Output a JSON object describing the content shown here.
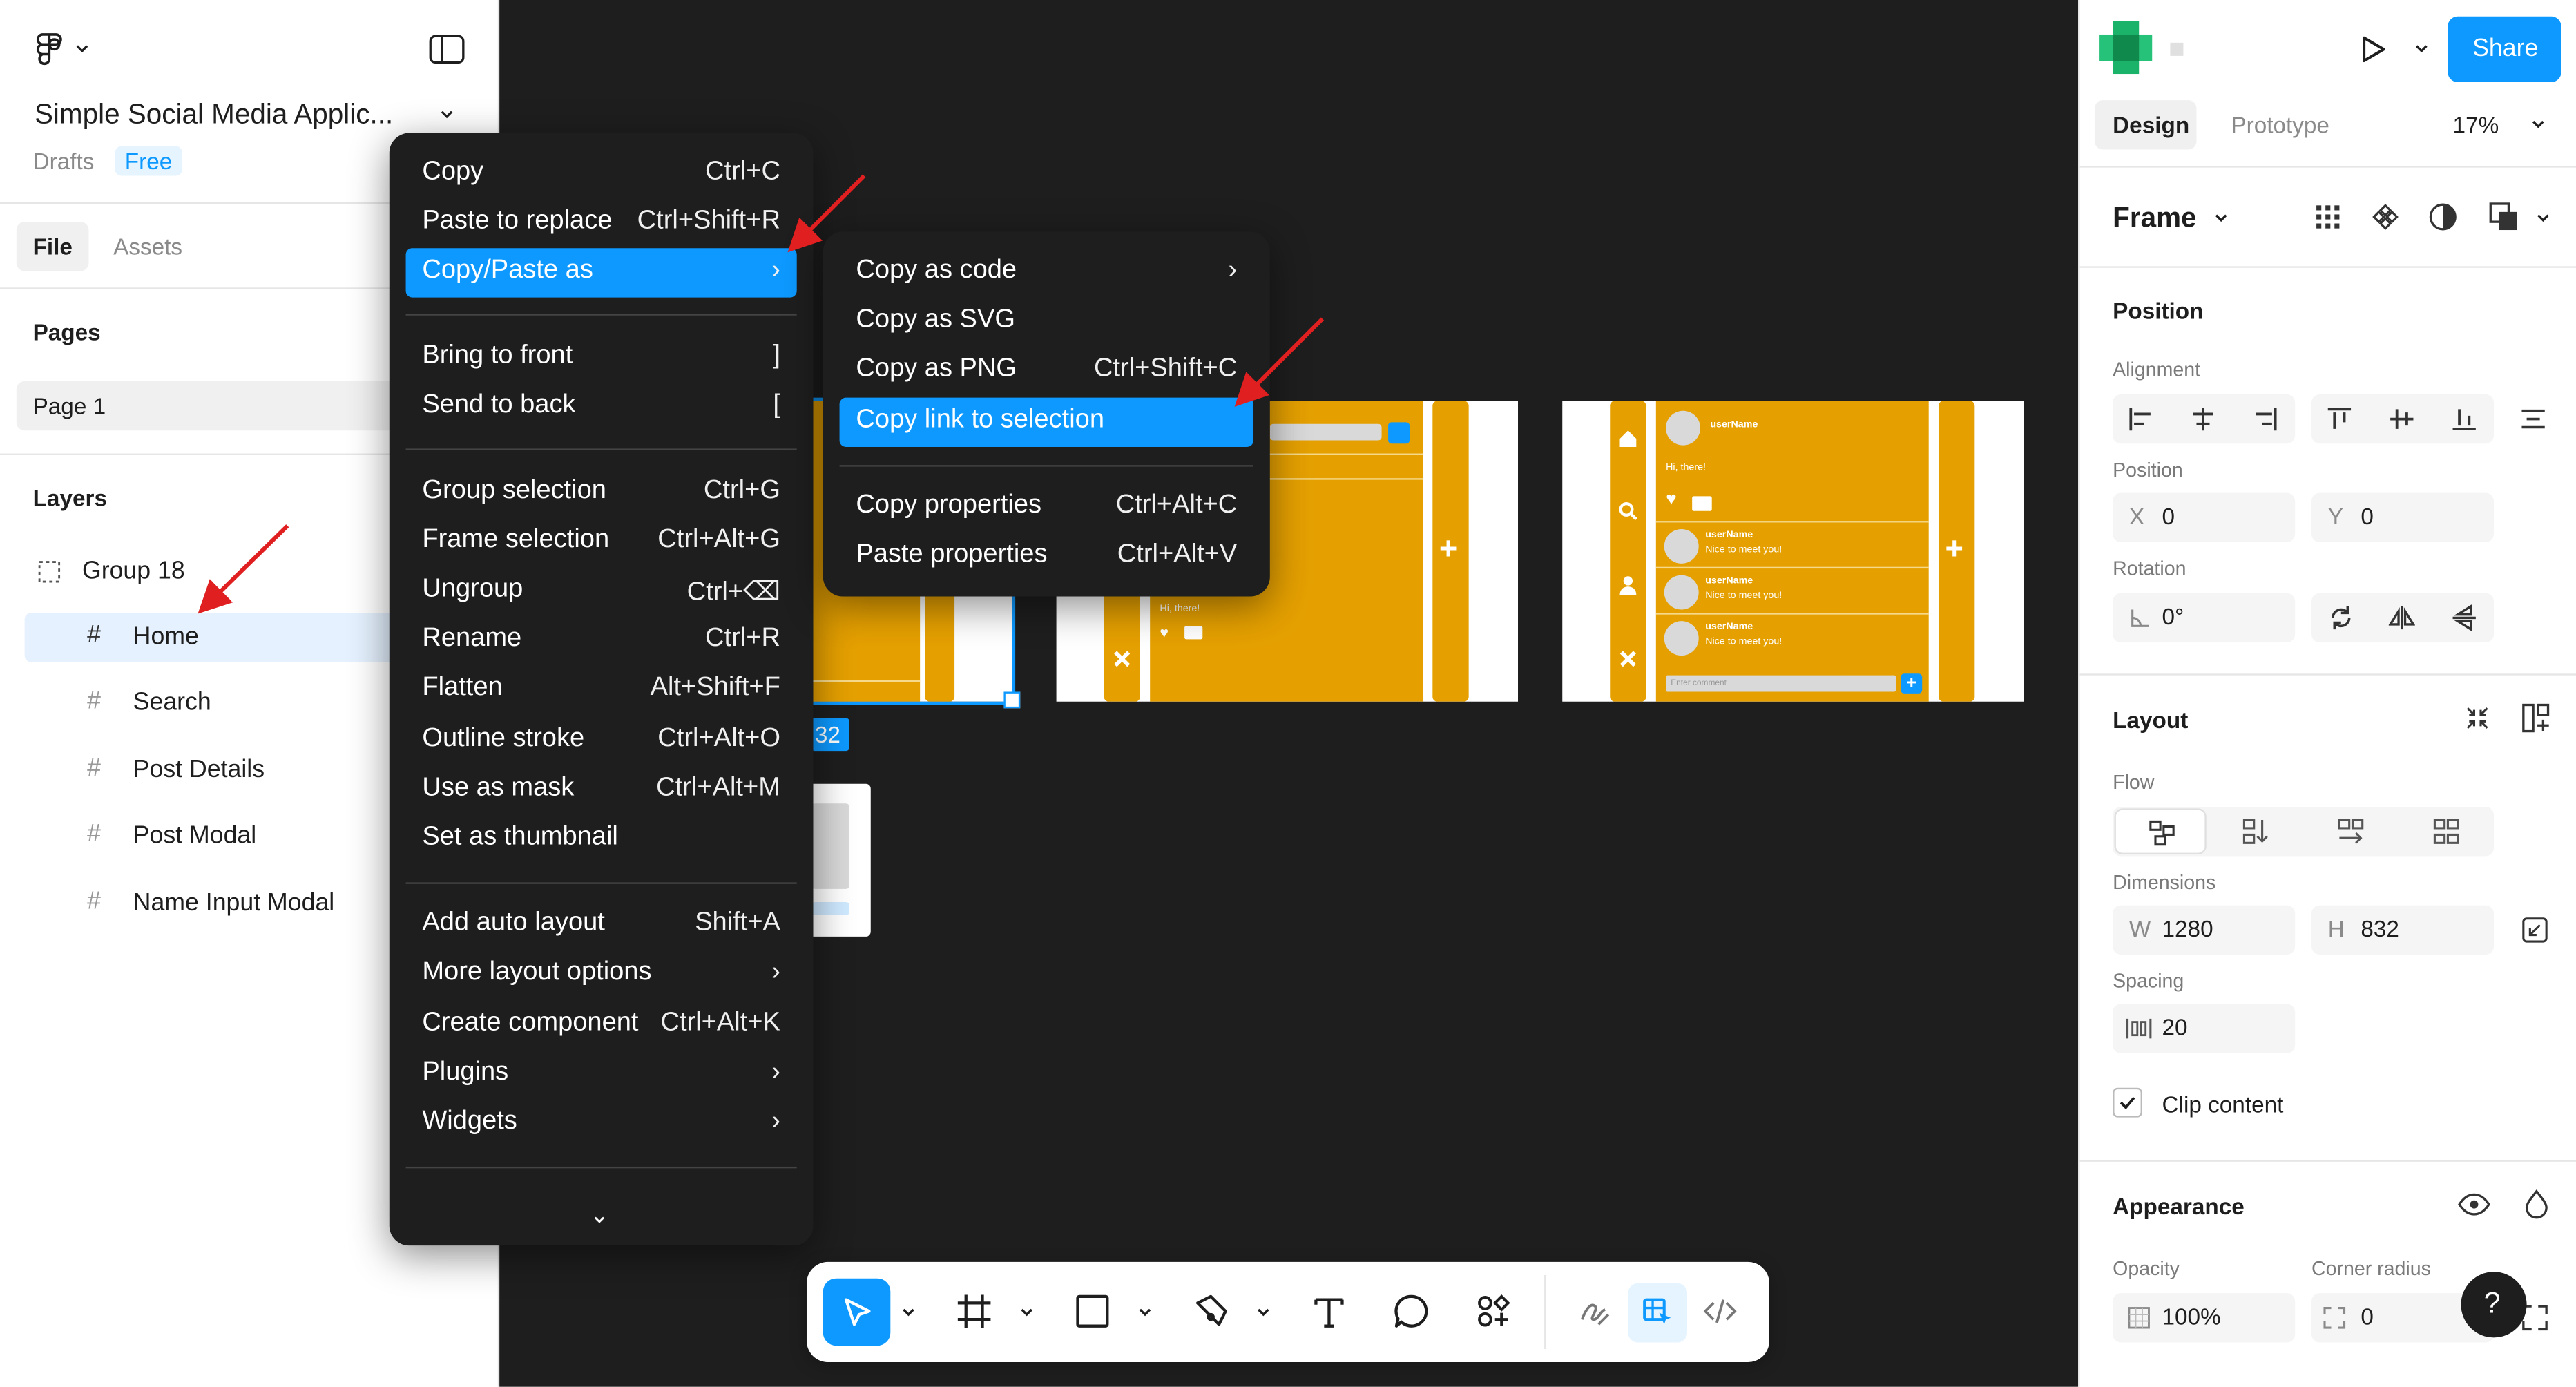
{
  "left_panel": {
    "project_title": "Simple Social Media Applic...",
    "drafts_label": "Drafts",
    "plan_badge": "Free",
    "tabs": [
      "File",
      "Assets"
    ],
    "pages_heading": "Pages",
    "pages": [
      "Page 1"
    ],
    "layers_heading": "Layers",
    "layers": [
      "Group 18",
      "Home",
      "Search",
      "Post Details",
      "Post Modal",
      "Name Input Modal"
    ]
  },
  "context_menu": {
    "items": [
      {
        "label": "Copy",
        "shortcut": "Ctrl+C"
      },
      {
        "label": "Paste to replace",
        "shortcut": "Ctrl+Shift+R"
      },
      {
        "label": "Copy/Paste as",
        "shortcut": "›"
      },
      {
        "label": "Bring to front",
        "shortcut": "]"
      },
      {
        "label": "Send to back",
        "shortcut": "["
      },
      {
        "label": "Group selection",
        "shortcut": "Ctrl+G"
      },
      {
        "label": "Frame selection",
        "shortcut": "Ctrl+Alt+G"
      },
      {
        "label": "Ungroup",
        "shortcut": "Ctrl+⌫"
      },
      {
        "label": "Rename",
        "shortcut": "Ctrl+R"
      },
      {
        "label": "Flatten",
        "shortcut": "Alt+Shift+F"
      },
      {
        "label": "Outline stroke",
        "shortcut": "Ctrl+Alt+O"
      },
      {
        "label": "Use as mask",
        "shortcut": "Ctrl+Alt+M"
      },
      {
        "label": "Set as thumbnail",
        "shortcut": ""
      },
      {
        "label": "Add auto layout",
        "shortcut": "Shift+A"
      },
      {
        "label": "More layout options",
        "shortcut": "›"
      },
      {
        "label": "Create component",
        "shortcut": "Ctrl+Alt+K"
      },
      {
        "label": "Plugins",
        "shortcut": "›"
      },
      {
        "label": "Widgets",
        "shortcut": "›"
      }
    ],
    "more_chevron": "⌄"
  },
  "submenu": {
    "items": [
      {
        "label": "Copy as code",
        "shortcut": "›"
      },
      {
        "label": "Copy as SVG",
        "shortcut": ""
      },
      {
        "label": "Copy as PNG",
        "shortcut": "Ctrl+Shift+C"
      },
      {
        "label": "Copy link to selection",
        "shortcut": ""
      },
      {
        "label": "Copy properties",
        "shortcut": "Ctrl+Alt+C"
      },
      {
        "label": "Paste properties",
        "shortcut": "Ctrl+Alt+V"
      }
    ]
  },
  "canvas": {
    "selection_size_badge": "32",
    "frame_text": {
      "user_name": "userName",
      "greeting": "Hi, there!",
      "comment_text": "Nice to meet you!",
      "comment_placeholder": "Enter comment"
    }
  },
  "right_panel": {
    "share_label": "Share",
    "tabs": [
      "Design",
      "Prototype"
    ],
    "zoom": "17%",
    "frame_label": "Frame",
    "position_heading": "Position",
    "alignment_label": "Alignment",
    "position_label": "Position",
    "x_key": "X",
    "x_value": "0",
    "y_key": "Y",
    "y_value": "0",
    "rotation_label": "Rotation",
    "rotation_value": "0°",
    "layout_heading": "Layout",
    "flow_label": "Flow",
    "dimensions_label": "Dimensions",
    "w_key": "W",
    "w_value": "1280",
    "h_key": "H",
    "h_value": "832",
    "spacing_label": "Spacing",
    "spacing_value": "20",
    "clip_content_label": "Clip content",
    "appearance_heading": "Appearance",
    "opacity_label": "Opacity",
    "opacity_value": "100%",
    "corner_radius_label": "Corner radius",
    "corner_radius_value": "0",
    "help_label": "?"
  },
  "colors": {
    "accent": "#0d99ff",
    "canvas_bg": "#1e1e1e",
    "frame_yellow": "#e5a000",
    "annotation_arrow": "#e02020"
  }
}
